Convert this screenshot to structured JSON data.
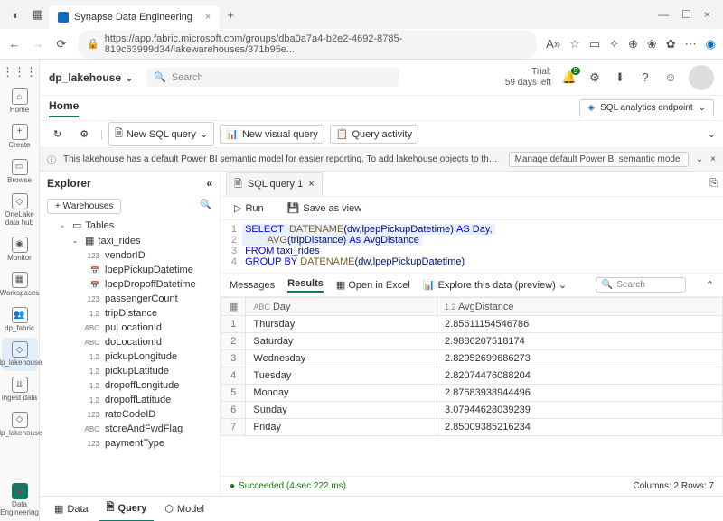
{
  "browser": {
    "tab_title": "Synapse Data Engineering",
    "url": "https://app.fabric.microsoft.com/groups/dba0a7a4-b2e2-4692-8785-819c63999d34/lakewarehouses/371b95e..."
  },
  "rail": {
    "items": [
      {
        "label": "Home"
      },
      {
        "label": "Create"
      },
      {
        "label": "Browse"
      },
      {
        "label": "OneLake data hub"
      },
      {
        "label": "Monitor"
      },
      {
        "label": "Workspaces"
      },
      {
        "label": "dp_fabric"
      },
      {
        "label": "dp_lakehouse"
      },
      {
        "label": "ingest data"
      },
      {
        "label": "dp_lakehouse"
      },
      {
        "label": "Data Engineering"
      }
    ]
  },
  "topbar": {
    "title": "dp_lakehouse",
    "search_placeholder": "Search",
    "trial_label": "Trial:",
    "trial_days": "59 days left",
    "notif_count": "5"
  },
  "home": {
    "tab": "Home",
    "endpoint": "SQL analytics endpoint"
  },
  "toolbar": {
    "new_sql": "New SQL query",
    "new_visual": "New visual query",
    "activity": "Query activity"
  },
  "info": {
    "msg": "This lakehouse has a default Power BI semantic model for easier reporting. To add lakehouse objects to the model, go to Manage default seman...",
    "manage": "Manage default Power BI semantic model"
  },
  "explorer": {
    "title": "Explorer",
    "warehouses": "Warehouses",
    "folder": "Tables",
    "table": "taxi_rides",
    "columns": [
      {
        "t": "123",
        "n": "vendorID"
      },
      {
        "t": "📅",
        "n": "lpepPickupDatetime"
      },
      {
        "t": "📅",
        "n": "lpepDropoffDatetime"
      },
      {
        "t": "123",
        "n": "passengerCount"
      },
      {
        "t": "1.2",
        "n": "tripDistance"
      },
      {
        "t": "ABC",
        "n": "puLocationId"
      },
      {
        "t": "ABC",
        "n": "doLocationId"
      },
      {
        "t": "1.2",
        "n": "pickupLongitude"
      },
      {
        "t": "1.2",
        "n": "pickupLatitude"
      },
      {
        "t": "1.2",
        "n": "dropoffLongitude"
      },
      {
        "t": "1.2",
        "n": "dropoffLatitude"
      },
      {
        "t": "123",
        "n": "rateCodeID"
      },
      {
        "t": "ABC",
        "n": "storeAndFwdFlag"
      },
      {
        "t": "123",
        "n": "paymentType"
      }
    ]
  },
  "query": {
    "tab": "SQL query 1",
    "run": "Run",
    "save": "Save as view",
    "code": {
      "l1a": "SELECT",
      "l1b": "DATENAME",
      "l1c": "(dw,lpepPickupDatetime)",
      "l1d": "AS",
      "l1e": "Day",
      "l2a": "AVG",
      "l2b": "(tripDistance)",
      "l2c": "As",
      "l2d": "AvgDistance",
      "l3a": "FROM",
      "l3b": "taxi_rides",
      "l4a": "GROUP",
      "l4b": "BY",
      "l4c": "DATENAME",
      "l4d": "(dw,lpepPickupDatetime)"
    }
  },
  "results": {
    "tab_messages": "Messages",
    "tab_results": "Results",
    "open_excel": "Open in Excel",
    "explore": "Explore this data (preview)",
    "search": "Search",
    "col1_type": "ABC",
    "col1": "Day",
    "col2_type": "1.2",
    "col2": "AvgDistance",
    "rows": [
      {
        "n": "1",
        "day": "Thursday",
        "avg": "2.85611154546786"
      },
      {
        "n": "2",
        "day": "Saturday",
        "avg": "2.9886207518174"
      },
      {
        "n": "3",
        "day": "Wednesday",
        "avg": "2.82952699686273"
      },
      {
        "n": "4",
        "day": "Tuesday",
        "avg": "2.82074476088204"
      },
      {
        "n": "5",
        "day": "Monday",
        "avg": "2.87683938944496"
      },
      {
        "n": "6",
        "day": "Sunday",
        "avg": "3.07944628039239"
      },
      {
        "n": "7",
        "day": "Friday",
        "avg": "2.85009385216234"
      }
    ]
  },
  "status": {
    "ok": "Succeeded (4 sec 222 ms)",
    "cols": "Columns: 2 Rows: 7"
  },
  "btabs": {
    "data": "Data",
    "query": "Query",
    "model": "Model"
  }
}
